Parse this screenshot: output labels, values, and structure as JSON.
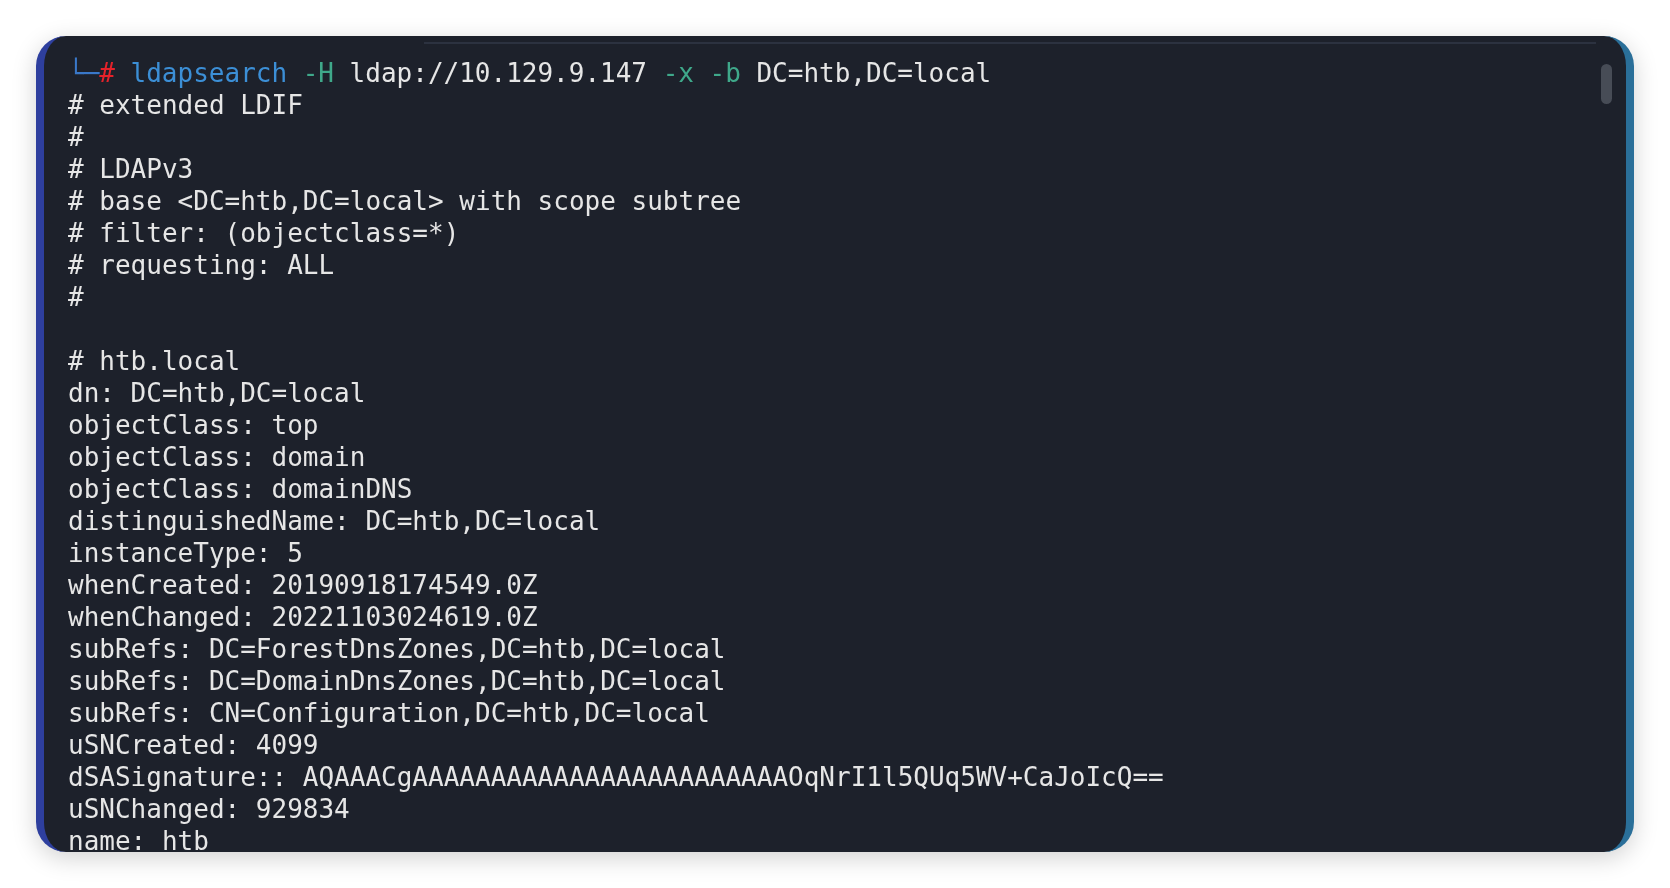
{
  "prompt": {
    "corner": "└─",
    "symbol": "#",
    "tokens": [
      {
        "kind": "command",
        "text": "ldapsearch"
      },
      {
        "kind": "flag",
        "text": "-H"
      },
      {
        "kind": "arg",
        "text": "ldap://10.129.9.147"
      },
      {
        "kind": "flag",
        "text": "-x"
      },
      {
        "kind": "flag",
        "text": "-b"
      },
      {
        "kind": "arg",
        "text": "DC=htb,DC=local"
      }
    ]
  },
  "output_blocks": [
    [
      "# extended LDIF",
      "#",
      "# LDAPv3",
      "# base <DC=htb,DC=local> with scope subtree",
      "# filter: (objectclass=*)",
      "# requesting: ALL",
      "#"
    ],
    [
      "# htb.local",
      "dn: DC=htb,DC=local",
      "objectClass: top",
      "objectClass: domain",
      "objectClass: domainDNS",
      "distinguishedName: DC=htb,DC=local",
      "instanceType: 5",
      "whenCreated: 20190918174549.0Z",
      "whenChanged: 20221103024619.0Z",
      "subRefs: DC=ForestDnsZones,DC=htb,DC=local",
      "subRefs: DC=DomainDnsZones,DC=htb,DC=local",
      "subRefs: CN=Configuration,DC=htb,DC=local",
      "uSNCreated: 4099",
      "dSASignature:: AQAAACgAAAAAAAAAAAAAAAAAAAAAAAAOqNrI1l5QUq5WV+CaJoIcQ==",
      "uSNChanged: 929834",
      "name: htb"
    ]
  ]
}
